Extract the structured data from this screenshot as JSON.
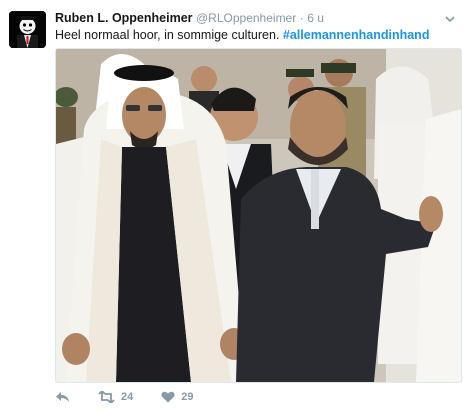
{
  "tweet": {
    "author_name": "Ruben L. Oppenheimer",
    "author_handle": "@RLOppenheimer",
    "separator": "·",
    "time": "6 u",
    "text": "Heel normaal hoor, in sommige culturen.",
    "hashtag": "#allemannenhandinhand",
    "retweet_count": "24",
    "like_count": "29"
  },
  "icons": {
    "reply": "reply-icon",
    "retweet": "retweet-icon",
    "like": "heart-icon",
    "more": "chevron-down-icon"
  },
  "colors": {
    "link": "#1b95e0",
    "muted": "#8899a6",
    "text": "#14171a"
  }
}
